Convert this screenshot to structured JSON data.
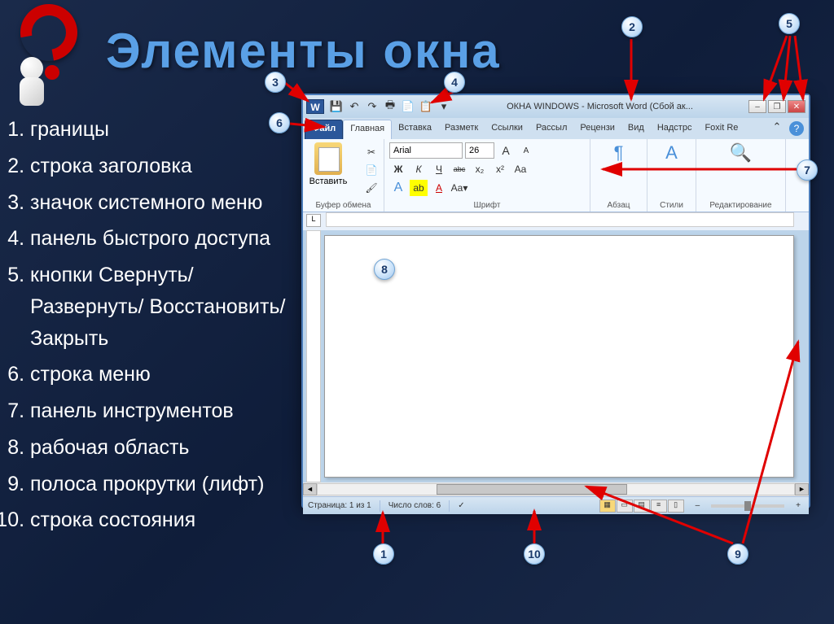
{
  "slide": {
    "title": "Элементы окна",
    "list": [
      "границы",
      "строка заголовка",
      "значок системного меню",
      "панель быстрого доступа",
      "кнопки Свернуть/ Развернуть/ Восстановить/ Закрыть",
      "строка меню",
      "панель инструментов",
      "рабочая область",
      "полоса прокрутки (лифт)",
      "строка состояния"
    ]
  },
  "word": {
    "app_icon": "W",
    "title_text": "ОКНА WINDOWS - Microsoft Word (Сбой ак...",
    "qat": {
      "save": "💾",
      "undo": "↶",
      "redo": "↷",
      "print": "🖶",
      "copy": "📄",
      "paste": "📋",
      "more": "▾"
    },
    "winctl": {
      "min": "–",
      "restore": "❐",
      "close": "✕"
    },
    "tabs": {
      "file": "Файл",
      "home": "Главная",
      "insert": "Вставка",
      "layout": "Разметк",
      "refs": "Ссылки",
      "mail": "Рассыл",
      "review": "Рецензи",
      "view": "Вид",
      "addins": "Надстрс",
      "foxit": "Foxit Re",
      "ribbon_toggle": "⌃",
      "help": "?"
    },
    "ribbon": {
      "clipboard": {
        "paste_label": "Вставить",
        "group_label": "Буфер обмена"
      },
      "font": {
        "name": "Arial",
        "size": "26",
        "bold": "Ж",
        "italic": "К",
        "underline": "Ч",
        "strike": "abc",
        "sub": "x₂",
        "sup": "x²",
        "grow": "A",
        "shrink": "A",
        "clear": "Aa",
        "color": "A",
        "highlight": "ab",
        "group_label": "Шрифт"
      },
      "paragraph": {
        "btn": "¶",
        "group_label": "Абзац"
      },
      "styles": {
        "glyph": "A",
        "group_label": "Стили"
      },
      "editing": {
        "glyph": "🔍",
        "group_label": "Редактирование"
      }
    },
    "status": {
      "page": "Страница: 1 из 1",
      "words": "Число слов: 6",
      "lang": "✓",
      "zoom_minus": "–",
      "zoom_plus": "+"
    }
  },
  "callouts": {
    "c1": "1",
    "c2": "2",
    "c3": "3",
    "c4": "4",
    "c5": "5",
    "c6": "6",
    "c7": "7",
    "c8": "8",
    "c9": "9",
    "c10": "10"
  }
}
